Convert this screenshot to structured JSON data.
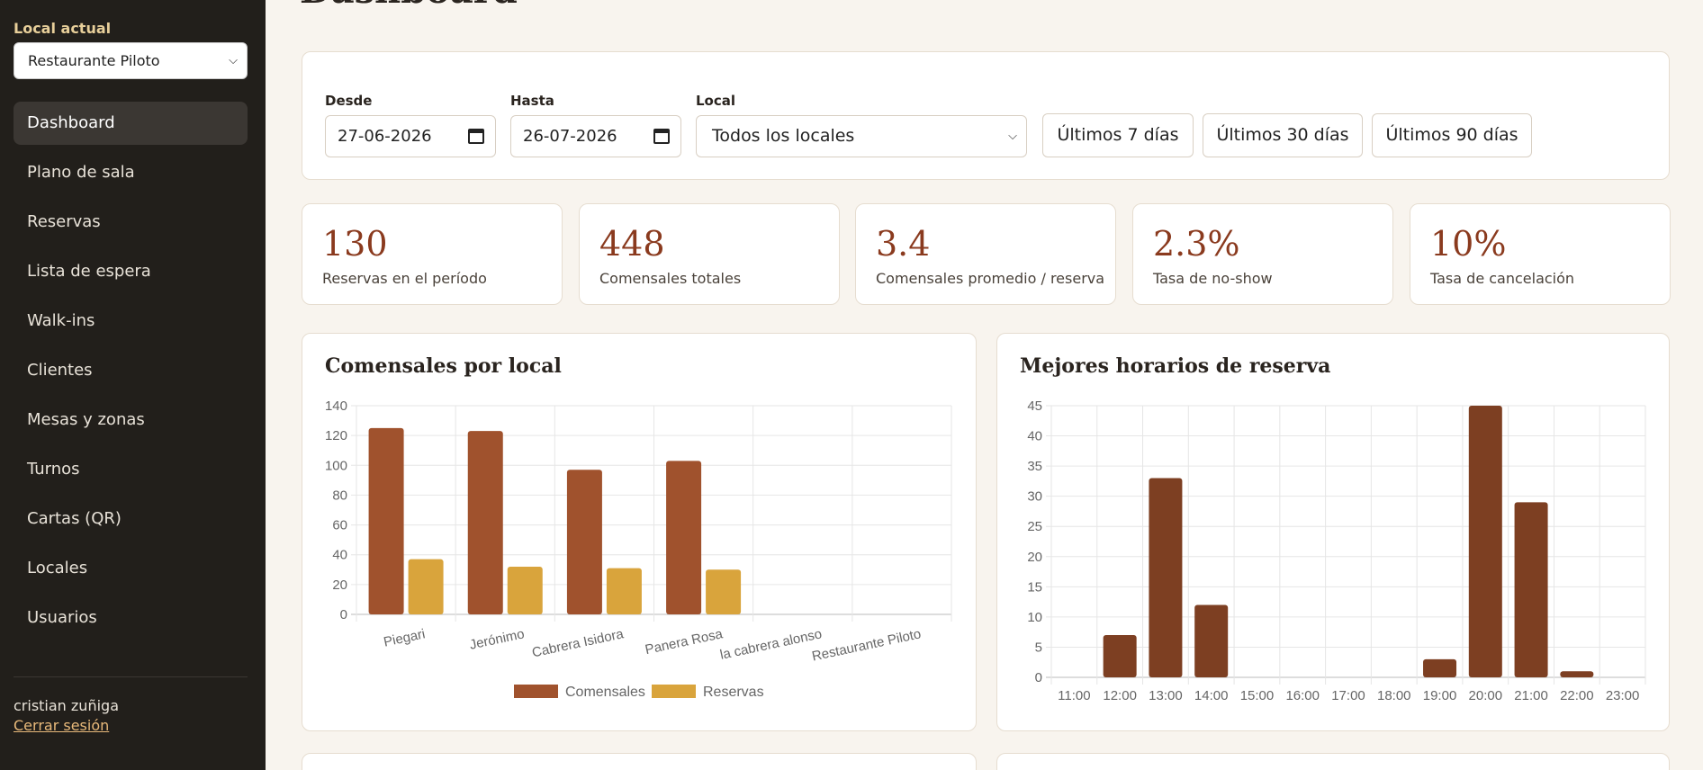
{
  "sidebar": {
    "local_label": "Local actual",
    "local_selected": "Restaurante Piloto",
    "items": [
      {
        "label": "Dashboard",
        "active": true
      },
      {
        "label": "Plano de sala"
      },
      {
        "label": "Reservas"
      },
      {
        "label": "Lista de espera"
      },
      {
        "label": "Walk-ins"
      },
      {
        "label": "Clientes"
      },
      {
        "label": "Mesas y zonas"
      },
      {
        "label": "Turnos"
      },
      {
        "label": "Cartas (QR)"
      },
      {
        "label": "Locales"
      },
      {
        "label": "Usuarios"
      }
    ],
    "user_name": "cristian zuñiga",
    "logout": "Cerrar sesión"
  },
  "header": {
    "title": "Dashboard"
  },
  "filters": {
    "desde_label": "Desde",
    "desde_value": "27-06-2026",
    "hasta_label": "Hasta",
    "hasta_value": "26-07-2026",
    "local_label": "Local",
    "local_value": "Todos los locales",
    "range_buttons": [
      "Últimos 7 días",
      "Últimos 30 días",
      "Últimos 90 días"
    ]
  },
  "kpis": [
    {
      "value": "130",
      "label": "Reservas en el período"
    },
    {
      "value": "448",
      "label": "Comensales totales"
    },
    {
      "value": "3.4",
      "label": "Comensales promedio / reserva"
    },
    {
      "value": "2.3%",
      "label": "Tasa de no-show"
    },
    {
      "value": "10%",
      "label": "Tasa de cancelación"
    }
  ],
  "colors": {
    "comensales": "#a0522d",
    "reservas": "#d9a43c",
    "horarios": "#7d3f22",
    "kpi_value": "#8a3a1e"
  },
  "chart_data": [
    {
      "type": "bar",
      "title": "Comensales por local",
      "categories": [
        "Piegari",
        "Jerónimo",
        "Cabrera Isidora",
        "Panera Rosa",
        "la cabrera alonso",
        "Restaurante Piloto"
      ],
      "series": [
        {
          "name": "Comensales",
          "values": [
            125,
            123,
            97,
            103,
            0,
            0
          ]
        },
        {
          "name": "Reservas",
          "values": [
            37,
            32,
            31,
            30,
            0,
            0
          ]
        }
      ],
      "ylim": [
        0,
        140
      ],
      "yticks": [
        0,
        20,
        40,
        60,
        80,
        100,
        120,
        140
      ],
      "grid": true,
      "legend": "bottom"
    },
    {
      "type": "bar",
      "title": "Mejores horarios de reserva",
      "categories": [
        "11:00",
        "12:00",
        "13:00",
        "14:00",
        "15:00",
        "16:00",
        "17:00",
        "18:00",
        "19:00",
        "20:00",
        "21:00",
        "22:00",
        "23:00"
      ],
      "values": [
        0,
        7,
        33,
        12,
        0,
        0,
        0,
        0,
        3,
        45,
        29,
        1,
        0
      ],
      "ylim": [
        0,
        45
      ],
      "yticks": [
        0,
        5,
        10,
        15,
        20,
        25,
        30,
        35,
        40,
        45
      ],
      "grid": true,
      "legend": "none"
    }
  ]
}
